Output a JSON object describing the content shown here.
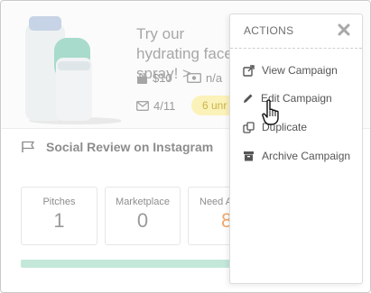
{
  "campaign": {
    "title": "Try our hydrating face spray! >",
    "price": "$10",
    "extra": "n/a",
    "messages": "4/11",
    "unread": "6 unr"
  },
  "social": {
    "label": "Social Review on Instagram"
  },
  "stats": [
    {
      "label": "Pitches",
      "value": "1"
    },
    {
      "label": "Marketplace",
      "value": "0"
    },
    {
      "label": "Need A",
      "value": "8"
    }
  ],
  "colors": {
    "accent_orange": "#f0a86c",
    "progress_green": "#c3e8da",
    "pill_yellow": "#fbf2b9"
  },
  "menu": {
    "title": "ACTIONS",
    "items": [
      {
        "label": "View Campaign",
        "icon": "external-link-icon"
      },
      {
        "label": "Edit Campaign",
        "icon": "pencil-icon"
      },
      {
        "label": "Duplicate",
        "icon": "duplicate-icon"
      },
      {
        "label": "Archive Campaign",
        "icon": "archive-icon"
      }
    ]
  }
}
